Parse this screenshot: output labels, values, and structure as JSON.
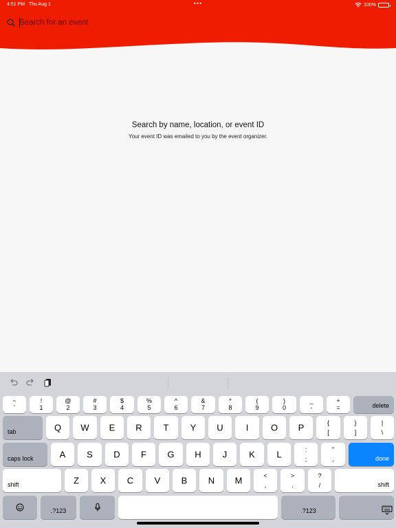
{
  "status_bar": {
    "time": "4:51 PM",
    "date": "Thu Aug 1",
    "dots": "•••",
    "battery": "100%"
  },
  "search": {
    "placeholder": "Search for an event"
  },
  "empty_state": {
    "title": "Search by name, location, or event ID",
    "subtitle": "Your event ID was emailed to you by the event organizer."
  },
  "colors": {
    "header_red": "#ee1c00",
    "keyboard_bg": "#d3d5db",
    "done_blue": "#0a84ff"
  },
  "keyboard": {
    "toolbar_icons": [
      "undo-icon",
      "redo-icon",
      "paste-icon"
    ],
    "row1": [
      {
        "top": "~",
        "bot": "`"
      },
      {
        "top": "!",
        "bot": "1"
      },
      {
        "top": "@",
        "bot": "2"
      },
      {
        "top": "#",
        "bot": "3"
      },
      {
        "top": "$",
        "bot": "4"
      },
      {
        "top": "%",
        "bot": "5"
      },
      {
        "top": "^",
        "bot": "6"
      },
      {
        "top": "&",
        "bot": "7"
      },
      {
        "top": "*",
        "bot": "8"
      },
      {
        "top": "(",
        "bot": "9"
      },
      {
        "top": ")",
        "bot": "0"
      },
      {
        "top": "_",
        "bot": "-"
      },
      {
        "top": "+",
        "bot": "="
      }
    ],
    "delete": "delete",
    "tab": "tab",
    "row2": [
      "Q",
      "W",
      "E",
      "R",
      "T",
      "Y",
      "U",
      "I",
      "O",
      "P"
    ],
    "row2_sym": [
      {
        "top": "{",
        "bot": "["
      },
      {
        "top": "}",
        "bot": "]"
      },
      {
        "top": "|",
        "bot": "\\"
      }
    ],
    "caps_lock": "caps lock",
    "row3": [
      "A",
      "S",
      "D",
      "F",
      "G",
      "H",
      "J",
      "K",
      "L"
    ],
    "row3_sym": [
      {
        "top": ":",
        "bot": ";"
      },
      {
        "top": "\"",
        "bot": ","
      }
    ],
    "done": "done",
    "shift": "shift",
    "row4": [
      "Z",
      "X",
      "C",
      "V",
      "B",
      "N",
      "M"
    ],
    "row4_sym": [
      {
        "top": "<",
        "bot": ","
      },
      {
        "top": ">",
        "bot": "."
      },
      {
        "top": "?",
        "bot": "/"
      }
    ],
    "numbers": ".?123"
  }
}
